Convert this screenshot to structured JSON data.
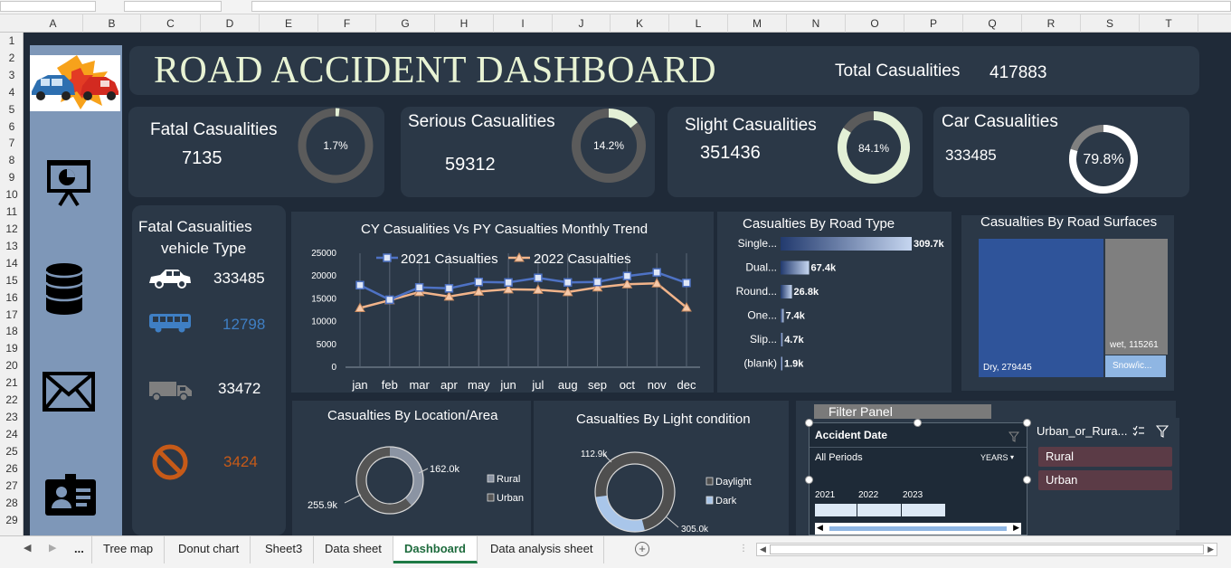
{
  "excel": {
    "columns": [
      "A",
      "B",
      "C",
      "D",
      "E",
      "F",
      "G",
      "H",
      "I",
      "J",
      "K",
      "L",
      "M",
      "N",
      "O",
      "P",
      "Q",
      "R",
      "S",
      "T"
    ],
    "rows": [
      "1",
      "2",
      "3",
      "4",
      "5",
      "6",
      "7",
      "8",
      "9",
      "10",
      "11",
      "12",
      "13",
      "14",
      "15",
      "16",
      "17",
      "18",
      "19",
      "20",
      "21",
      "22",
      "23",
      "24",
      "25",
      "26",
      "27",
      "28",
      "29"
    ],
    "tabs": [
      "...",
      "Tree map",
      "Donut chart",
      "Sheet3",
      "Data sheet",
      "Dashboard",
      "Data analysis sheet"
    ],
    "active_tab": "Dashboard",
    "add_sheet": "+"
  },
  "dashboard": {
    "title": "ROAD ACCIDENT DASHBOARD",
    "total_label": "Total Casualities",
    "total_value": "417883"
  },
  "kpis": {
    "fatal": {
      "label": "Fatal  Casualities",
      "value": "7135",
      "pct_label": "1.7%",
      "pct": 1.7
    },
    "serious": {
      "label": "Serious  Casualities",
      "value": "59312",
      "pct_label": "14.2%",
      "pct": 14.2
    },
    "slight": {
      "label": "Slight  Casualities",
      "value": "351436",
      "pct_label": "84.1%",
      "pct": 84.1
    },
    "car": {
      "label": "Car Casualities",
      "value": "333485",
      "pct_label": "79.8%",
      "pct": 79.8
    }
  },
  "vehicle": {
    "title_line1": "Fatal Casualities",
    "title_line2": "vehicle Type",
    "items": [
      {
        "icon": "car-icon",
        "value": "333485",
        "color": "#ffffff"
      },
      {
        "icon": "bus-icon",
        "value": "12798",
        "color": "#3f7fc4"
      },
      {
        "icon": "truck-icon",
        "value": "33472",
        "color": "#ffffff"
      },
      {
        "icon": "no-entry-icon",
        "value": "3424",
        "color": "#c65a18"
      }
    ]
  },
  "colors": {
    "sheet_bg": "#1f2a38",
    "panel": "#2b3847",
    "sidebar": "#7e97b8",
    "line_2021": "#4e72c4",
    "line_2022": "#f2b48a",
    "donut_track": "#5b5b5b",
    "donut_fill": "#e3f0d6",
    "accent_orange": "#c65a18",
    "accent_blue": "#3f7fc4"
  },
  "chart_data": [
    {
      "type": "line",
      "title": "CY Casualities  Vs PY   Casualties Monthly Trend",
      "categories": [
        "jan",
        "feb",
        "mar",
        "apr",
        "may",
        "jun",
        "jul",
        "aug",
        "sep",
        "oct",
        "nov",
        "dec"
      ],
      "series": [
        {
          "name": "2021 Casualties",
          "values": [
            18000,
            14800,
            17500,
            17300,
            18700,
            18600,
            19600,
            18600,
            18700,
            20000,
            20800,
            18500
          ]
        },
        {
          "name": "2022 Casualties",
          "values": [
            13000,
            14700,
            16500,
            15500,
            16600,
            17100,
            17000,
            16500,
            17500,
            18200,
            18400,
            13100
          ]
        }
      ],
      "y_ticks": [
        "0",
        "5000",
        "10000",
        "15000",
        "20000",
        "25000"
      ],
      "ylim": [
        0,
        25000
      ],
      "legend": "top"
    },
    {
      "type": "bar",
      "title": "Casualties By Road Type",
      "categories": [
        "Single...",
        "Dual...",
        "Round...",
        "One...",
        "Slip...",
        "(blank)"
      ],
      "values": [
        309.7,
        67.4,
        26.8,
        7.4,
        4.7,
        1.9
      ],
      "value_labels": [
        "309.7k",
        "67.4k",
        "26.8k",
        "7.4k",
        "4.7k",
        "1.9k"
      ]
    },
    {
      "type": "heatmap",
      "title": "Casualties By Road  Surfaces",
      "items": [
        {
          "label": "Dry, 279445",
          "value": 279445,
          "color": "#2f549a"
        },
        {
          "label": "wet, 115261",
          "value": 115261,
          "color": "#7f7f7f"
        },
        {
          "label": "Snow/ic...",
          "value": 23177,
          "color": "#8fb6e3"
        }
      ]
    },
    {
      "type": "pie",
      "title": "Casualties By Location/Area",
      "labels": [
        "Rural",
        "Urban"
      ],
      "values": [
        162.0,
        255.9
      ],
      "value_labels": [
        "162.0k",
        "255.9k"
      ],
      "colors": [
        "#8b94a3",
        "#555555"
      ],
      "legend": "right"
    },
    {
      "type": "pie",
      "title": "Casualties By Light condition",
      "labels": [
        "Daylight",
        "Dark"
      ],
      "values": [
        305.0,
        112.9
      ],
      "value_labels": [
        "305.0k",
        "112.9k"
      ],
      "colors": [
        "#4f4f4f",
        "#a9c6ea"
      ],
      "legend": "right"
    }
  ],
  "filter": {
    "title": "Filter Panel",
    "date_header": "Accident Date",
    "all_periods": "All Periods",
    "years": "YEARS",
    "year_labels": [
      "2021",
      "2022",
      "2023"
    ],
    "urban_header": "Urban_or_Rura...",
    "urban_items": [
      "Rural",
      "Urban"
    ]
  }
}
